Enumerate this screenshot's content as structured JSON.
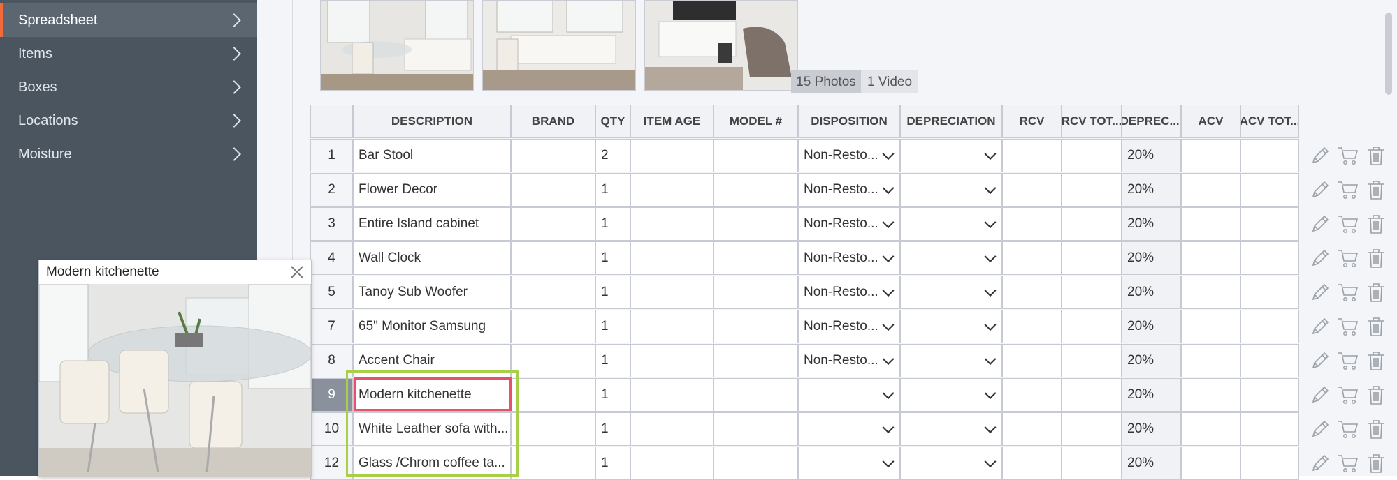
{
  "sidebar": {
    "items": [
      {
        "label": "Spreadsheet",
        "active": true
      },
      {
        "label": "Items",
        "active": false
      },
      {
        "label": "Boxes",
        "active": false
      },
      {
        "label": "Locations",
        "active": false
      },
      {
        "label": "Moisture",
        "active": false
      }
    ]
  },
  "gallery": {
    "photos_label": "15 Photos",
    "video_label": "1 Video"
  },
  "table": {
    "headers": [
      "DESCRIPTION",
      "BRAND",
      "QTY",
      "ITEM AGE",
      "MODEL #",
      "DISPOSITION",
      "DEPRECIATION",
      "RCV",
      "RCV TOT...",
      "DEPREC....",
      "ACV",
      "ACV TOT..."
    ],
    "rows": [
      {
        "num": "1",
        "description": "Bar Stool",
        "qty": "2",
        "disposition": "Non-Resto...",
        "deprec": "20%"
      },
      {
        "num": "2",
        "description": "Flower Decor",
        "qty": "1",
        "disposition": "Non-Resto...",
        "deprec": "20%"
      },
      {
        "num": "3",
        "description": "Entire Island cabinet",
        "qty": "1",
        "disposition": "Non-Resto...",
        "deprec": "20%"
      },
      {
        "num": "4",
        "description": "Wall Clock",
        "qty": "1",
        "disposition": "Non-Resto...",
        "deprec": "20%"
      },
      {
        "num": "5",
        "description": "Tanoy Sub Woofer",
        "qty": "1",
        "disposition": "Non-Resto...",
        "deprec": "20%"
      },
      {
        "num": "7",
        "description": "65\" Monitor Samsung",
        "qty": "1",
        "disposition": "Non-Resto...",
        "deprec": "20%"
      },
      {
        "num": "8",
        "description": "Accent Chair",
        "qty": "1",
        "disposition": "Non-Resto...",
        "deprec": "20%"
      },
      {
        "num": "9",
        "description": "Modern kitchenette",
        "qty": "1",
        "disposition": "",
        "deprec": "20%",
        "selected": true
      },
      {
        "num": "10",
        "description": "White Leather sofa with...",
        "qty": "1",
        "disposition": "",
        "deprec": "20%"
      },
      {
        "num": "12",
        "description": "Glass /Chrom coffee ta...",
        "qty": "1",
        "disposition": "",
        "deprec": "20%"
      }
    ]
  },
  "popup": {
    "title": "Modern kitchenette"
  },
  "colors": {
    "sidebar_bg": "#4b5560",
    "active_accent": "#f06a3c",
    "highlight_green": "#a7cf4a",
    "highlight_red": "#e5526a"
  },
  "icons": {
    "row_actions": [
      "pencil-icon",
      "cart-icon",
      "trash-icon"
    ],
    "close": "close-icon"
  }
}
